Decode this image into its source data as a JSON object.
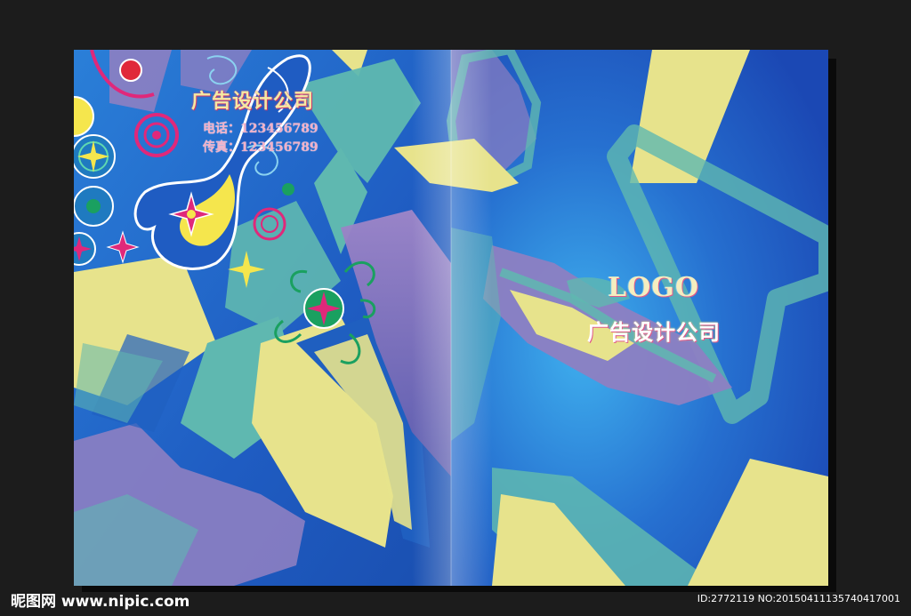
{
  "brochure": {
    "left_page": {
      "company_name": "广告设计公司",
      "phone": "电话：123456789",
      "fax": "传真：123456789"
    },
    "right_page": {
      "logo": "LOGO",
      "company_name": "广告设计公司"
    }
  },
  "watermark": {
    "site": "昵图网 www.nipic.com",
    "id_text": "ID:2772119 NO:20150411135740417001"
  },
  "colors": {
    "background": "#1c1c1c",
    "cover_blue": "#1f5fc0",
    "cover_blue_light": "#3aa0e8",
    "shape_yellow": "#e7e38c",
    "shape_teal": "#5fb8b0",
    "shape_purple": "#8d7fc2",
    "accent_pink": "#e0287a"
  }
}
